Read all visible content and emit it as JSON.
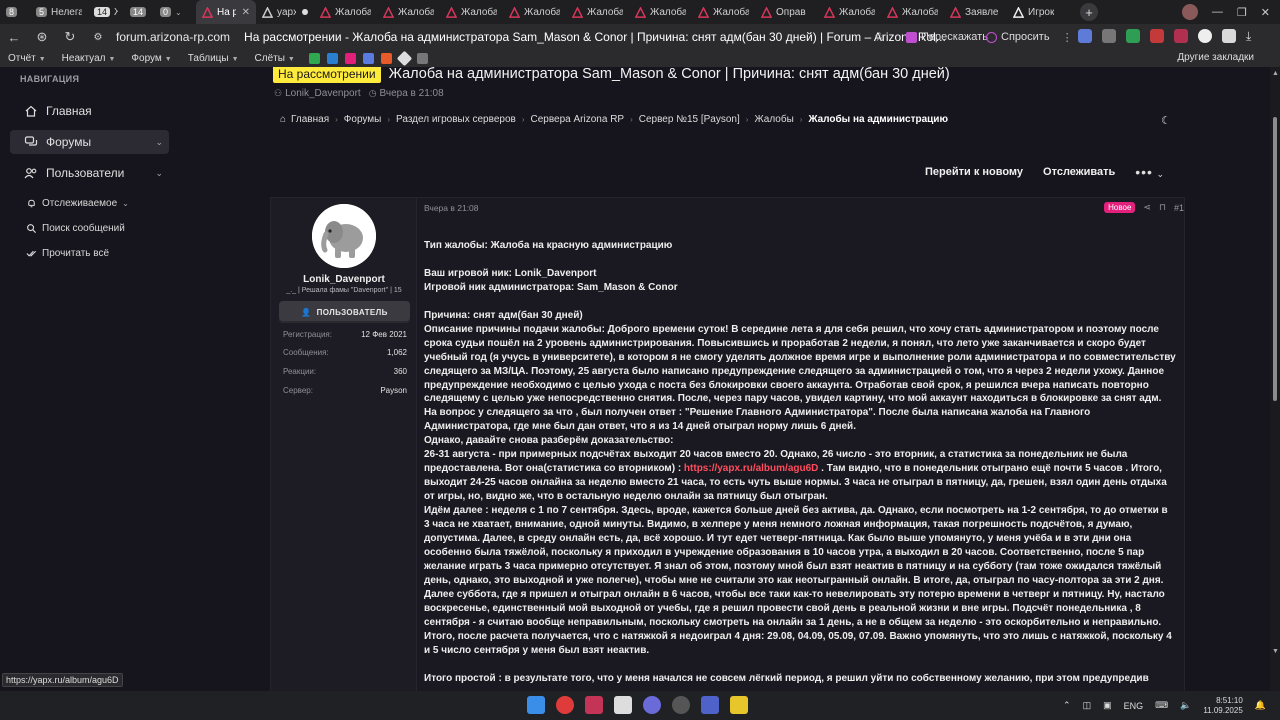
{
  "tabs": [
    {
      "num": "8",
      "label": ""
    },
    {
      "num": "5",
      "label": "Нелегалы"
    },
    {
      "num": "14",
      "label": "Жб"
    },
    {
      "num": "14",
      "label": ""
    },
    {
      "num": "0",
      "label": ""
    },
    {
      "label": "На ра",
      "active": true
    },
    {
      "label": "yapx"
    },
    {
      "label": "Жалоба"
    },
    {
      "label": "Жалоба"
    },
    {
      "label": "Жалоба"
    },
    {
      "label": "Жалоба"
    },
    {
      "label": "Жалоба"
    },
    {
      "label": "Жалоба"
    },
    {
      "label": "Жалоба"
    },
    {
      "label": "Оправ"
    },
    {
      "label": "Жалоба"
    },
    {
      "label": "Жалоба"
    },
    {
      "label": "Заявле"
    },
    {
      "label": "Игрок"
    }
  ],
  "address": {
    "host": "forum.arizona-rp.com",
    "title": "На рассмотрении - Жалоба на администратора Sam_Mason & Conor | Причина: снят адм(бан 30 дней) | Forum – Arizona Rol..."
  },
  "ext_buttons": {
    "retell": "Перескажать",
    "ask": "Спросить"
  },
  "bookmarks": {
    "items": [
      "Отчёт",
      "Неактуал",
      "Форум",
      "Таблицы",
      "Слёты"
    ],
    "other": "Другие закладки"
  },
  "sidebar": {
    "heading": "НАВИГАЦИЯ",
    "items": [
      {
        "label": "Главная"
      },
      {
        "label": "Форумы"
      },
      {
        "label": "Пользователи"
      }
    ],
    "sub": [
      "Отслеживаемое",
      "Поиск сообщений",
      "Прочитать всё"
    ]
  },
  "thread": {
    "prefix": "На рассмотрении",
    "title": "Жалоба на администратора Sam_Mason & Conor | Причина: снят адм(бан 30 дней)",
    "author": "Lonik_Davenport",
    "date": "Вчера в 21:08"
  },
  "breadcrumb": [
    "Главная",
    "Форумы",
    "Раздел игровых серверов",
    "Сервера Arizona RP",
    "Сервер №15 [Payson]",
    "Жалобы",
    "Жалобы на администрацию"
  ],
  "actions": {
    "goto_new": "Перейти к новому",
    "watch": "Отслеживать",
    "more": "•••"
  },
  "user": {
    "name": "Lonik_Davenport",
    "title": "_._ | Решала фамы \"Davenport\" | 15",
    "role": "ПОЛЬЗОВАТЕЛЬ",
    "stats": [
      {
        "k": "Регистрация:",
        "v": "12 Фев 2021"
      },
      {
        "k": "Сообщения:",
        "v": "1,062"
      },
      {
        "k": "Реакции:",
        "v": "360"
      },
      {
        "k": "Сервер:",
        "v": "Payson"
      }
    ]
  },
  "post": {
    "date": "Вчера в 21:08",
    "badge": "Новое",
    "number": "#1",
    "l1": "Тип жалобы: Жалоба на красную администрацию",
    "l2": "Ваш игровой ник: Lonik_Davenport",
    "l3": "Игровой ник администратора: Sam_Mason & Conor",
    "l4": "Причина: снят адм(бан 30 дней)",
    "p1": "Описание причины подачи жалобы: Доброго времени суток! В середине лета я для себя решил, что хочу стать администратором и поэтому после срока судьи пошёл на 2 уровень администрирования. Повысившись и проработав 2 недели, я понял, что лето уже заканчивается и скоро будет учебный год (я учусь в университете), в котором я не смогу уделять должное время игре и выполнение роли администратора и по совместительству следящего за МЗ/ЦА. Поэтому, 25 августа было написано предупреждение следящего за администрацией о том, что я через 2 недели ухожу. Данное предупреждение необходимо с целью ухода с поста без блокировки своего аккаунта. Отработав свой срок, я решился вчера написать повторно следящему с целью уже непосредственно снятия. После, через пару часов, увидел картину, что мой аккаунт находиться в блокировке за снят адм. На вопрос у следящего за что , был получен ответ : \"Решение Главного Администратора\". После была написана жалоба на Главного Администратора, где мне был дан ответ, что я из 14 дней отыграл норму лишь 6 дней.",
    "p2": "Однако, давайте снова разберём доказательство:",
    "p3a": "26-31 августа - при примерных подсчётах выходит 20 часов вместо 20. Однако, 26 число - это вторник, а статистика за понедельник не была предоставлена. Вот она(статистика со вторником) : ",
    "link": "https://yapx.ru/album/agu6D",
    "p3b": " . Там видно, что в понедельник отыграно ещё почти 5 часов . Итого, выходит 24-25 часов онлайна за неделю вместо 21 часа, то есть чуть выше нормы. 3 часа не отыграл в пятницу, да, грешен, взял один день отдыха от игры, но, видно же, что в остальную неделю онлайн за пятницу был отыгран.",
    "p4": "Идём далее : неделя с 1 по 7 сентября. Здесь, вроде, кажется больше дней без актива, да. Однако, если посмотреть на 1-2 сентября, то до отметки в 3 часа не хватает, внимание, одной минуты. Видимо, в хелпере у меня немного ложная информация, такая погрешность подсчётов, я думаю, допустима. Далее, в среду онлайн есть, да, всё хорошо. И тут едет четверг-пятница. Как было выше упомянуто, у меня учёба и в эти дни она особенно была тяжёлой, поскольку я приходил в учреждение образования в 10 часов утра, а выходил в 20 часов. Соответственно, после 5 пар желание играть 3 часа примерно отсутствует. Я знал об этом, поэтому мной был взят неактив в пятницу и на субботу (там тоже ожидался тяжёлый день, однако, это выходной и уже полегче), чтобы мне не считали это как неотыгранный онлайн. В итоге, да, отыграл по часу-полтора за эти 2 дня. Далее суббота, где я пришел и отыграл онлайн в 6 часов, чтобы все таки как-то невелировать эту потерю времени в четверг и пятницу. Ну, настало воскресенье, единственный мой выходной от учебы, где я решил провести свой день в реальной жизни и вне игры. Подсчёт понедельника , 8 сентября - я считаю вообще неправильным, поскольку смотреть на онлайн за 1 день, а не в общем за неделю - это оскорбительно и неправильно. Итого, после расчета получается, что с натяжкой я недоиграл 4 дня: 29.08, 04.09, 05.09, 07.09. Важно упомянуть, что это лишь с натяжкой, поскольку 4 и 5 число сентября у меня был взят неактив.",
    "p5": "Итого простой : в результате того, что у меня начался не совсем лёгкий период, я решил уйти по собственному желанию, при этом предупредив"
  },
  "status_url": "https://yapx.ru/album/agu6D",
  "taskbar": {
    "lang": "ENG",
    "time": "8:51:10",
    "date": "11.09.2025"
  },
  "colors": {
    "accent_link": "#ff4d5e",
    "prefix_yellow": "#ffeb3b",
    "badge_new": "#e3207b"
  }
}
